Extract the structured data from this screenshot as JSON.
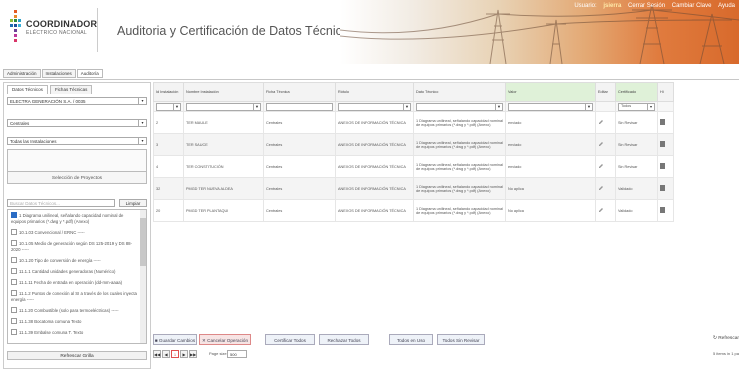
{
  "header": {
    "org_name": "COORDINADOR",
    "org_sub": "ELÉCTRICO NACIONAL",
    "app_title": "Auditoria y Certificación de Datos Técnicos Aplicados",
    "user_label": "Usuario:",
    "user_name": "jsierra",
    "logout": "Cerrar Sesión",
    "change_pw": "Cambiar Clave",
    "help": "Ayuda"
  },
  "nav_tabs": [
    "Administración",
    "Instalaciones",
    "Auditoría"
  ],
  "left": {
    "subtabs": [
      "Datos Técnicos",
      "Fichas Técnicas"
    ],
    "company_select": "ELECTRA GENERACIÓN S.A. / 0035",
    "type_select": "Centrales",
    "installations_select": "Todas las Instalaciones",
    "projects_button": "Selección de Proyectos",
    "search_placeholder": "Buscar Datos Técnicos...",
    "clear_button": "Limpiar",
    "checklist": [
      {
        "label": "1 Diagrama unilineal, señalando capacidad nominal de equipos primarios (*.dwg y *.pdf) (Anexo)",
        "checked": true
      },
      {
        "label": "10.1.03 Convencional / ERNC -----",
        "checked": false
      },
      {
        "label": "10.1.05 Medio de generación según DS 125-2019 y DS 88-2020 -----",
        "checked": false
      },
      {
        "label": "10.1.20 Tipo de conversión de energía -----",
        "checked": false
      },
      {
        "label": "11.1.1 Cantidad unidades generadoras (Numérico)",
        "checked": false
      },
      {
        "label": "11.1.11 Fecha de entrada en operación (dd-mm-aaaa)",
        "checked": false
      },
      {
        "label": "11.1.2 Puntos de conexión al SI a través de los cuales inyecta energía -----",
        "checked": false
      },
      {
        "label": "11.1.20 Combustible (solo para termoeléctricas) -----",
        "checked": false
      },
      {
        "label": "11.1.38 Bocatoma comuna Texto",
        "checked": false
      },
      {
        "label": "11.1.39 Embalse comuna T. Texto",
        "checked": false
      }
    ],
    "refresh_grid": "Refrescar Grilla"
  },
  "grid": {
    "columns": [
      "Id Instalación",
      "Nombre Instalación",
      "Ficha Técnica",
      "Rótulo",
      "Dato Técnico",
      "Valor",
      "Editar",
      "Certificado",
      "Hi"
    ],
    "filter_cert_value": "Todos",
    "rows": [
      {
        "id": "2",
        "nombre": "TER MAULE",
        "ficha": "Centrales",
        "rotulo": "ANEXOS DE INFORMACIÓN TÉCNICA",
        "dato": "1 Diagrama unilineal, señalando capacidad nominal de equipos primarios (*.dwg y *.pdf) (Anexo)",
        "valor": "enviado",
        "cert": "Sin Revisar"
      },
      {
        "id": "3",
        "nombre": "TER SAUCE",
        "ficha": "Centrales",
        "rotulo": "ANEXOS DE INFORMACIÓN TÉCNICA",
        "dato": "1 Diagrama unilineal, señalando capacidad nominal de equipos primarios (*.dwg y *.pdf) (Anexo)",
        "valor": "enviado",
        "cert": "Sin Revisar"
      },
      {
        "id": "4",
        "nombre": "TER CONSTITUCIÓN",
        "ficha": "Centrales",
        "rotulo": "ANEXOS DE INFORMACIÓN TÉCNICA",
        "dato": "1 Diagrama unilineal, señalando capacidad nominal de equipos primarios (*.dwg y *.pdf) (Anexo)",
        "valor": "enviado",
        "cert": "Sin Revisar"
      },
      {
        "id": "32",
        "nombre": "PMGD TER NUEVA ALDEA",
        "ficha": "Centrales",
        "rotulo": "ANEXOS DE INFORMACIÓN TÉCNICA",
        "dato": "1 Diagrama unilineal, señalando capacidad nominal de equipos primarios (*.dwg y *.pdf) (Anexo)",
        "valor": "No aplica",
        "cert": "Validado"
      },
      {
        "id": "20",
        "nombre": "PMGD TER PLANTAQUI",
        "ficha": "Centrales",
        "rotulo": "ANEXOS DE INFORMACIÓN TÉCNICA",
        "dato": "1 Diagrama unilineal, señalando capacidad nominal de equipos primarios (*.dwg y *.pdf) (Anexo)",
        "valor": "No aplica",
        "cert": "Validado"
      }
    ]
  },
  "actions": {
    "save": "Guardar Cambios",
    "cancel": "Cancelar Operación",
    "cert_all": "Certificar Todos",
    "reject_all": "Rechazar Todos",
    "all_in_use": "Todos en Uso",
    "all_unreviewed": "Todos Sin Revisar",
    "refresh": "Refrescar"
  },
  "pager": {
    "first": "◀◀",
    "prev": "◀",
    "current": "1",
    "next": "▶",
    "last": "▶▶",
    "page_size_label": "Page size:",
    "page_size": "500",
    "items": "5 items in 1 pa"
  },
  "icons": {
    "edit": "pencil-icon",
    "doc": "document-icon",
    "refresh": "refresh-icon",
    "save": "save-icon",
    "cancel": "close-icon"
  }
}
